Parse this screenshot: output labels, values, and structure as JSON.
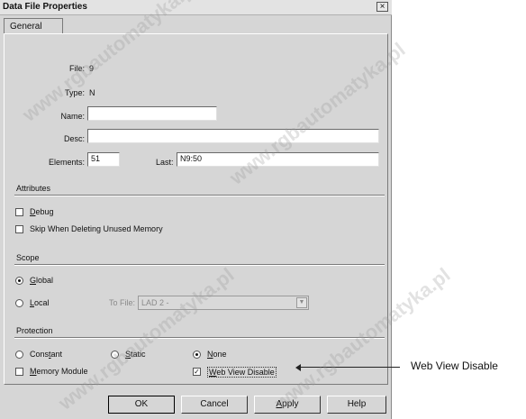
{
  "window": {
    "title": "Data File Properties",
    "close_glyph": "×"
  },
  "tab": {
    "label": "General"
  },
  "fields": {
    "file_label": "File:",
    "file_value": "9",
    "type_label": "Type:",
    "type_value": "N",
    "name_label": "Name:",
    "name_value": "",
    "desc_label": "Desc:",
    "desc_value": "",
    "elements_label": "Elements:",
    "elements_value": "51",
    "last_label": "Last:",
    "last_value": "N9:50"
  },
  "attributes": {
    "section": "Attributes",
    "debug_label": "Debug",
    "debug_checked": false,
    "skip_label": "Skip When Deleting Unused Memory",
    "skip_checked": false
  },
  "scope": {
    "section": "Scope",
    "global_label": "Global",
    "global_selected": true,
    "local_label": "Local",
    "local_selected": false,
    "tofile_label": "To File:",
    "tofile_value": "LAD 2 -"
  },
  "protection": {
    "section": "Protection",
    "constant_label": "Constant",
    "static_label": "Static",
    "none_label": "None",
    "selected": "None",
    "memory_label": "Memory Module",
    "memory_checked": false,
    "webview_label": "Web View Disable",
    "webview_checked": true
  },
  "buttons": {
    "ok": "OK",
    "cancel": "Cancel",
    "apply": "Apply",
    "help": "Help"
  },
  "callout": {
    "label": "Web View Disable"
  },
  "watermark": "www.rgbautomatyka.pl"
}
